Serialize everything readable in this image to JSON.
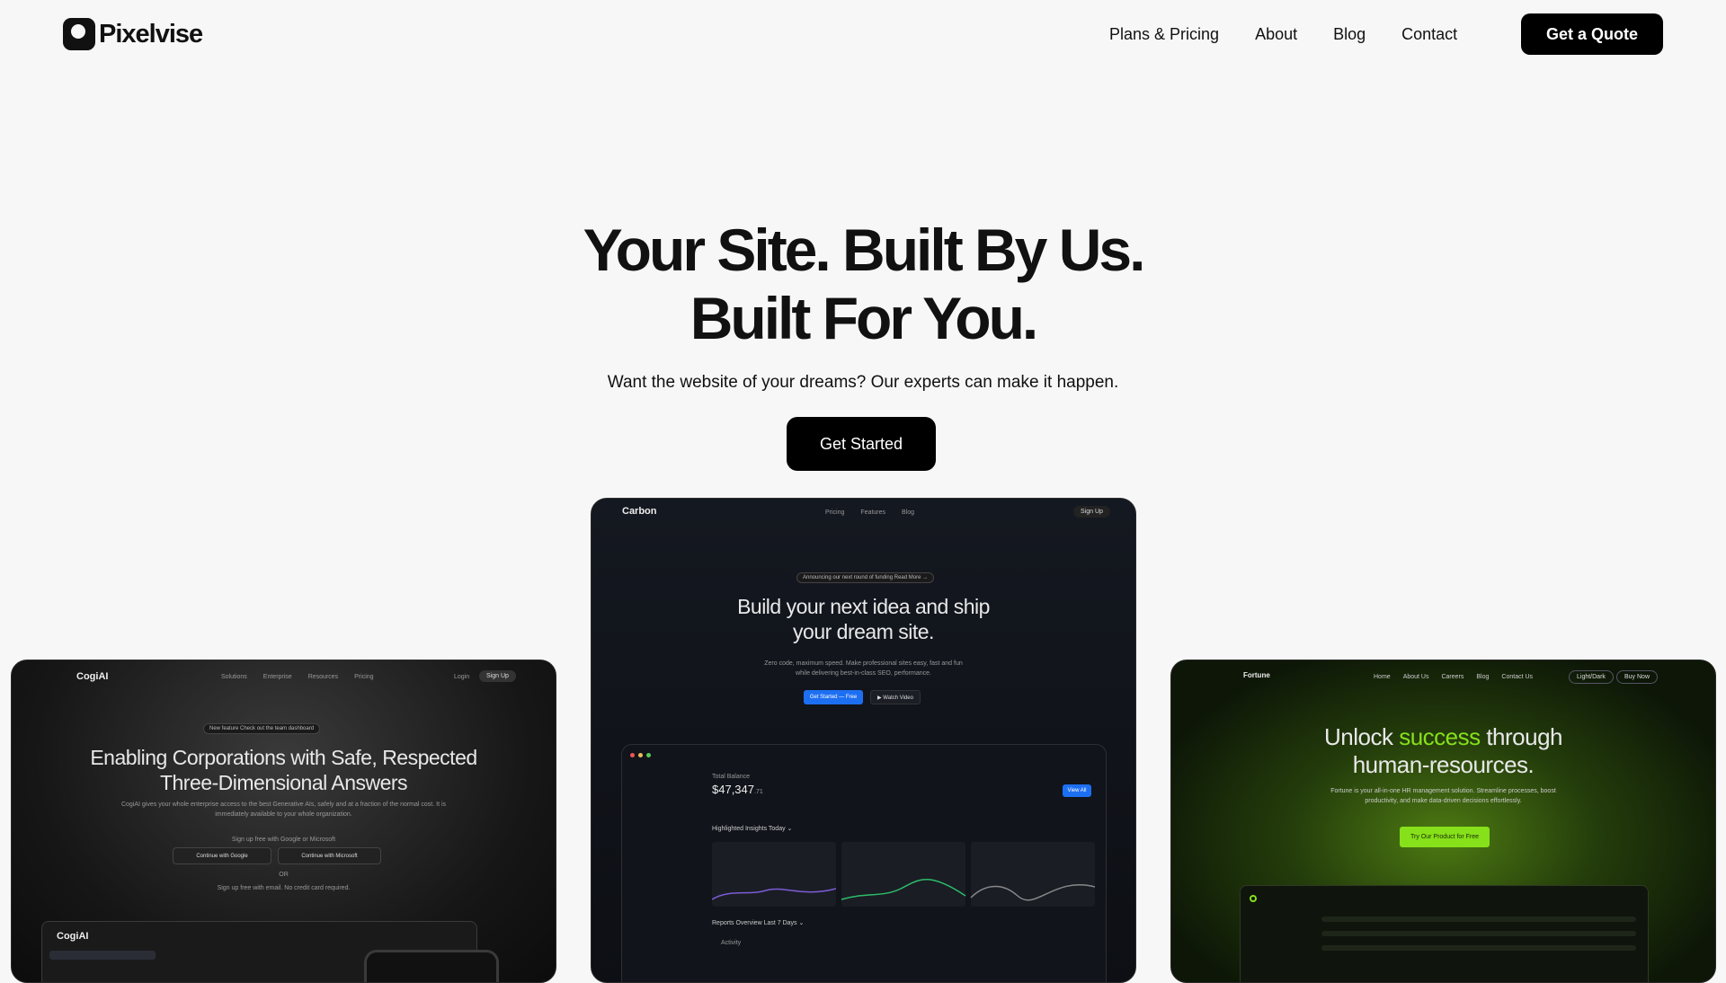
{
  "brand": {
    "name": "Pixelvise"
  },
  "nav": {
    "items": [
      "Plans & Pricing",
      "About",
      "Blog",
      "Contact"
    ],
    "cta": "Get a Quote"
  },
  "hero": {
    "title_line1": "Your Site. Built By Us.",
    "title_line2": "Built For You.",
    "subtitle": "Want the website of your dreams? Our experts can make it happen.",
    "cta": "Get Started"
  },
  "showcase": {
    "left": {
      "logo": "CogiAI",
      "links": [
        "Solutions",
        "Enterprise",
        "Resources",
        "Pricing"
      ],
      "login": "Login",
      "signup": "Sign Up",
      "badge": "New feature  Check out the team dashboard",
      "title": "Enabling Corporations with Safe, Respected Three-Dimensional Answers",
      "body": "CogiAI gives your whole enterprise access to the best Generative AIs, safely and at a fraction of the normal cost. It is immediately available to your whole organization.",
      "signup_hint": "Sign up free with Google or Microsoft",
      "google_btn": "Continue with Google",
      "ms_btn": "Continue with Microsoft",
      "or": "OR",
      "email_hint": "Sign up free with email.  No credit card required.",
      "app_logo": "CogiAI"
    },
    "center": {
      "logo": "Carbon",
      "links": [
        "Pricing",
        "Features",
        "Blog"
      ],
      "signup": "Sign Up",
      "badge": "Announcing our next round of funding  Read More →",
      "title": "Build your next idea and ship your dream site.",
      "body": "Zero code, maximum speed. Make professional sites easy, fast and fun while delivering best-in-class SEO, performance.",
      "cta_primary": "Get Started — Free",
      "cta_secondary": "▶ Watch Video",
      "dash_label": "Total Balance",
      "dash_value": "$47,347",
      "dash_value_suffix": ".71",
      "dash_btn": "View All",
      "insights": "Highlighted Insights  Today ⌄",
      "reports": "Reports Overview  Last 7 Days ⌄",
      "activity": "Activity"
    },
    "right": {
      "logo": "Fortune",
      "links": [
        "Home",
        "About Us",
        "Careers",
        "Blog",
        "Contact Us"
      ],
      "toggle": "Light/Dark",
      "buy": "Buy Now",
      "title_pre": "Unlock ",
      "title_accent": "success",
      "title_post": " through human-resources.",
      "body": "Fortune is your all-in-one HR management solution. Streamline processes, boost productivity, and make data-driven decisions effortlessly.",
      "cta": "Try Our Product for Free"
    }
  },
  "colors": {
    "accent_green": "#86e01a",
    "button_black": "#000000",
    "blue": "#1d6ff2"
  }
}
